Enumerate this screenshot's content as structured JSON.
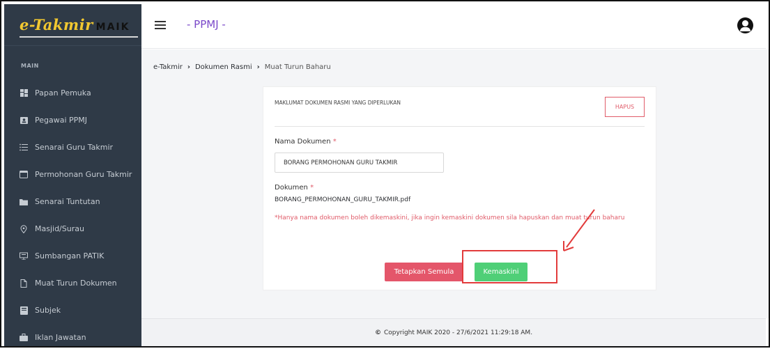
{
  "sidebar": {
    "logo_text": "e-Takmir",
    "logo_suffix": "MAIK",
    "section_label": "MAIN",
    "items": [
      {
        "label": "Papan Pemuka",
        "icon": "dashboard-icon"
      },
      {
        "label": "Pegawai PPMJ",
        "icon": "user-card-icon"
      },
      {
        "label": "Senarai Guru Takmir",
        "icon": "list-icon"
      },
      {
        "label": "Permohonan Guru Takmir",
        "icon": "window-icon"
      },
      {
        "label": "Senarai Tuntutan",
        "icon": "folder-icon"
      },
      {
        "label": "Masjid/Surau",
        "icon": "map-pin-icon"
      },
      {
        "label": "Sumbangan PATIK",
        "icon": "presentation-icon"
      },
      {
        "label": "Muat Turun Dokumen",
        "icon": "file-icon"
      },
      {
        "label": "Subjek",
        "icon": "book-icon"
      },
      {
        "label": "Iklan Jawatan",
        "icon": "briefcase-icon"
      }
    ]
  },
  "header": {
    "app_title": "- PPMJ -"
  },
  "breadcrumb": [
    "e-Takmir",
    "Dokumen Rasmi",
    "Muat Turun Baharu"
  ],
  "form": {
    "title": "MAKLUMAT DOKUMEN RASMI YANG DIPERLUKAN",
    "delete_label": "HAPUS",
    "name_label": "Nama Dokumen",
    "name_value": "BORANG PERMOHONAN GURU TAKMIR",
    "doc_label": "Dokumen",
    "required_mark": "*",
    "filename": "BORANG_PERMOHONAN_GURU_TAKMIR.pdf",
    "warning": "*Hanya nama dokumen boleh dikemaskini, jika ingin kemaskini dokumen sila hapuskan dan muat turun baharu",
    "reset_label": "Tetapkan Semula",
    "update_label": "Kemaskini"
  },
  "footer": {
    "copyright": "Copyright MAIK 2020 - 27/6/2021 11:29:18 AM."
  },
  "colors": {
    "sidebar_bg": "#2f3a47",
    "accent": "#7a48c9",
    "danger": "#e4566a",
    "success": "#4fcf77",
    "annotation": "#e23b3b"
  }
}
